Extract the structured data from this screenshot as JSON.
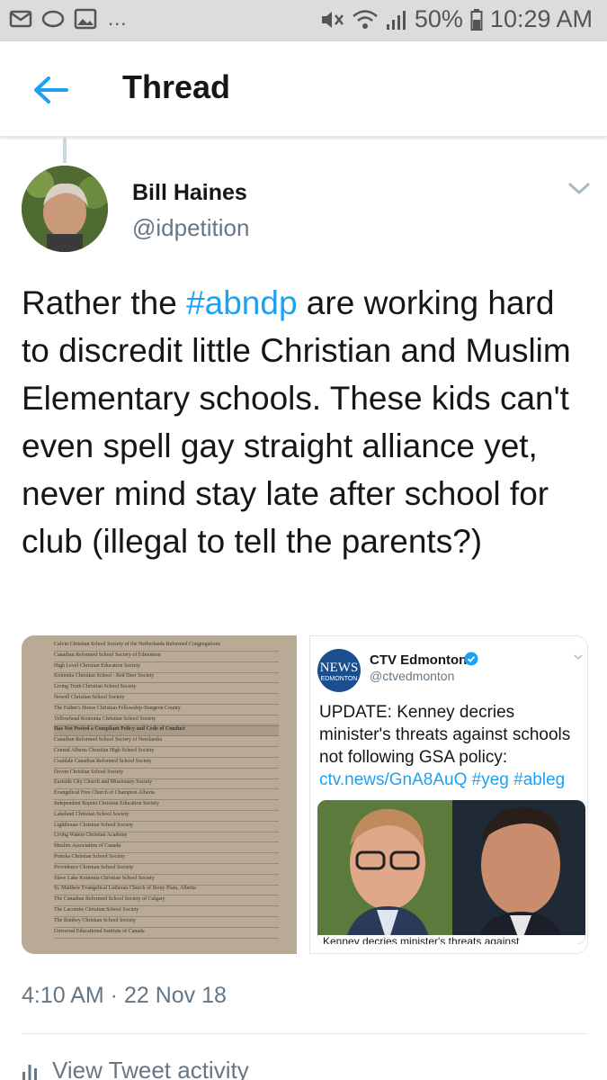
{
  "status_bar": {
    "battery": "50%",
    "time": "10:29 AM",
    "dots": "..."
  },
  "header": {
    "title": "Thread"
  },
  "tweet": {
    "author_name": "Bill Haines",
    "author_handle": "@idpetition",
    "text_before": "Rather the ",
    "hashtag": "#abndp",
    "text_after": " are working hard to discredit little Christian and Muslim Elementary schools. These kids can't even spell gay straight alliance yet, never mind stay late after school for club (illegal to tell the parents?)",
    "timestamp": "4:10 AM · 22 Nov 18",
    "activity_label": "View Tweet activity"
  },
  "document_image": {
    "rows": [
      "Calvin Christian School Society of the Netherlands Reformed Congregations",
      "Canadian Reformed School Society of Edmonton",
      "High Level Christian Education Society",
      "Koinonia Christian School - Red Deer Society",
      "Living Truth Christian School Society",
      "Newell Christian School Society",
      "The Father's House Christian Fellowship-Sturgeon County",
      "Yellowhead Koinonia Christian School Society",
      "Has Not Posted a Compliant Policy and Code of Conduct",
      "Canadian Reformed School Society of Neerlandia",
      "Central Alberta Christian High School Society",
      "Coaldale Canadian Reformed School Society",
      "Devon Christian School Society",
      "Eastside City Church and Missionary Society",
      "Evangelical Free Church of Champion Alberta",
      "Independent Baptist Christian Education Society",
      "Lakeland Christian School Society",
      "Lighthouse Christian School Society",
      "Living Waters Christian Academy",
      "Muslim Association of Canada",
      "Ponoka Christian School Society",
      "Providence Christian School Society",
      "Slave Lake Koinonia Christian School Society",
      "St. Matthew Evangelical Lutheran Church of Stony Plain, Alberta",
      "The Canadian Reformed School Society of Calgary",
      "The Lacombe Christian School Society",
      "The Rimbey Christian School Society",
      "Universal Educational Institute of Canada"
    ]
  },
  "embedded_tweet": {
    "logo_text": "NEWS",
    "logo_city": "EDMONTON",
    "name": "CTV Edmonton",
    "handle": "@ctvedmonton",
    "text": "UPDATE: Kenney decries minister's threats against schools not following GSA policy: ",
    "link": "ctv.news/GnA8AuQ #yeg #ableg",
    "photo_caption": "Kenney decries minister's threats against"
  },
  "colors": {
    "accent": "#1da1f2",
    "secondary_text": "#657786",
    "primary_text": "#14171a"
  }
}
